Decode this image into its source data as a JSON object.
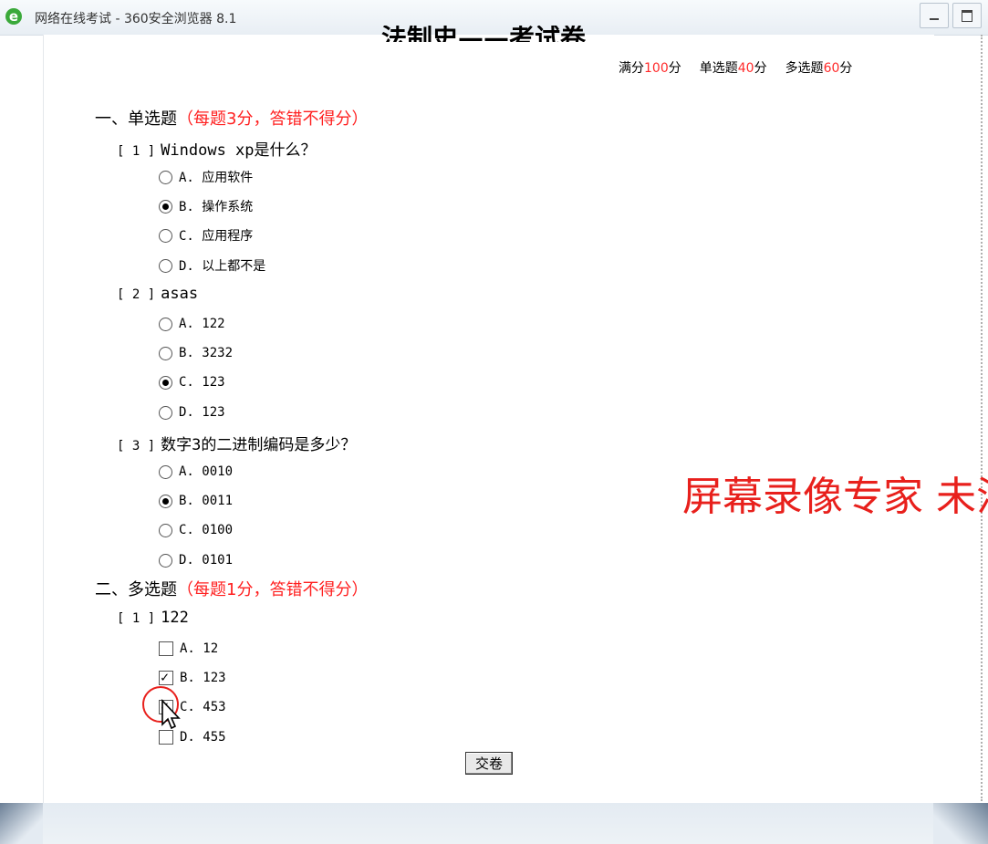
{
  "window": {
    "title": "网络在线考试 - 360安全浏览器 8.1",
    "icon": "ie-logo-icon"
  },
  "exam": {
    "title": "法制史——考试卷",
    "score_bar": {
      "full_label": "满分",
      "full_value": "100",
      "full_unit": "分",
      "single_label": "单选题",
      "single_value": "40",
      "single_unit": "分",
      "multi_label": "多选题",
      "multi_value": "60",
      "multi_unit": "分"
    }
  },
  "sections": [
    {
      "heading": "一、单选题",
      "note": "（每题3分，答错不得分）",
      "questions": [
        {
          "number": "[ 1 ]",
          "text": "Windows xp是什么？",
          "options": [
            {
              "label": "A. 应用软件",
              "checked": false
            },
            {
              "label": "B. 操作系统",
              "checked": true
            },
            {
              "label": "C. 应用程序",
              "checked": false
            },
            {
              "label": "D. 以上都不是",
              "checked": false
            }
          ]
        },
        {
          "number": "[ 2 ]",
          "text": "asas",
          "options": [
            {
              "label": "A. 122",
              "checked": false
            },
            {
              "label": "B. 3232",
              "checked": false
            },
            {
              "label": "C. 123",
              "checked": true
            },
            {
              "label": "D. 123",
              "checked": false
            }
          ]
        },
        {
          "number": "[ 3 ]",
          "text": "数字3的二进制编码是多少？",
          "options": [
            {
              "label": "A. 0010",
              "checked": false
            },
            {
              "label": "B. 0011",
              "checked": true
            },
            {
              "label": "C. 0100",
              "checked": false
            },
            {
              "label": "D. 0101",
              "checked": false
            }
          ]
        }
      ]
    },
    {
      "heading": "二、多选题",
      "note": "（每题1分，答错不得分）",
      "questions": [
        {
          "number": "[ 1 ]",
          "text": "122",
          "options": [
            {
              "label": "A. 12",
              "checked": false
            },
            {
              "label": "B. 123",
              "checked": true
            },
            {
              "label": "C. 453",
              "checked": true
            },
            {
              "label": "D. 455",
              "checked": false
            }
          ]
        }
      ]
    }
  ],
  "watermark": "屏幕录像专家 未注册",
  "submit_label": "交卷"
}
